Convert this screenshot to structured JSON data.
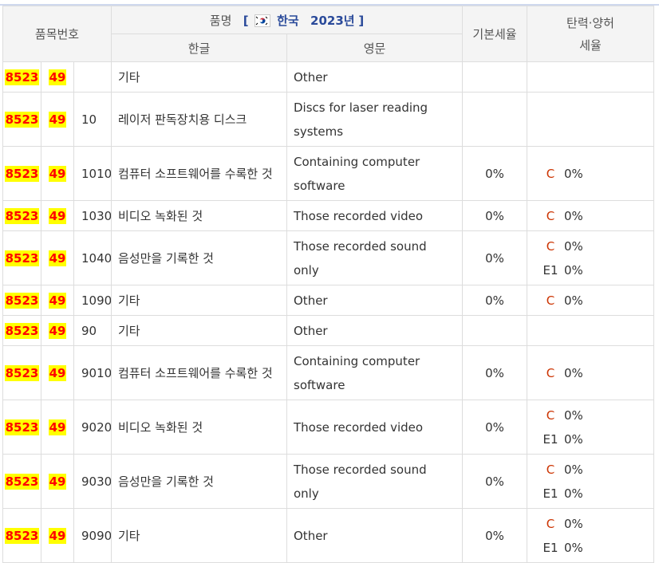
{
  "header": {
    "pumbun": "품목번호",
    "pummyeong": "품명",
    "bracket_open": "[",
    "country": "한국",
    "year": "2023년",
    "bracket_close": "]",
    "hangul": "한글",
    "english": "영문",
    "base_rate": "기본세율",
    "flex_rate_line1": "탄력·양허",
    "flex_rate_line2": "세율"
  },
  "flag_icon": "south-korea-flag-icon",
  "colors": {
    "highlight_bg": "#ffff00",
    "highlight_text": "#ff0000",
    "rate_code": "#cc3300",
    "title": "#2a4a9a"
  },
  "rows": [
    {
      "c1": "8523",
      "c2": "49",
      "c3": "",
      "kr": "기타",
      "en": "Other",
      "base": "",
      "rates": []
    },
    {
      "c1": "8523",
      "c2": "49",
      "c3": "10",
      "kr": "레이저 판독장치용 디스크",
      "en": "Discs for laser reading systems",
      "base": "",
      "rates": []
    },
    {
      "c1": "8523",
      "c2": "49",
      "c3": "1010",
      "kr": "컴퓨터 소프트웨어를 수록한 것",
      "en": "Containing computer software",
      "base": "0%",
      "rates": [
        {
          "code": "C",
          "value": "0%"
        }
      ]
    },
    {
      "c1": "8523",
      "c2": "49",
      "c3": "1030",
      "kr": "비디오 녹화된 것",
      "en": "Those recorded video",
      "base": "0%",
      "rates": [
        {
          "code": "C",
          "value": "0%"
        }
      ]
    },
    {
      "c1": "8523",
      "c2": "49",
      "c3": "1040",
      "kr": "음성만을 기록한 것",
      "en": "Those recorded sound only",
      "base": "0%",
      "rates": [
        {
          "code": "C",
          "value": "0%"
        },
        {
          "code": "E1",
          "value": "0%"
        }
      ]
    },
    {
      "c1": "8523",
      "c2": "49",
      "c3": "1090",
      "kr": "기타",
      "en": "Other",
      "base": "0%",
      "rates": [
        {
          "code": "C",
          "value": "0%"
        }
      ]
    },
    {
      "c1": "8523",
      "c2": "49",
      "c3": "90",
      "kr": "기타",
      "en": "Other",
      "base": "",
      "rates": []
    },
    {
      "c1": "8523",
      "c2": "49",
      "c3": "9010",
      "kr": "컴퓨터 소프트웨어를 수록한 것",
      "en": "Containing computer software",
      "base": "0%",
      "rates": [
        {
          "code": "C",
          "value": "0%"
        }
      ]
    },
    {
      "c1": "8523",
      "c2": "49",
      "c3": "9020",
      "kr": "비디오 녹화된 것",
      "en": "Those recorded video",
      "base": "0%",
      "rates": [
        {
          "code": "C",
          "value": "0%"
        },
        {
          "code": "E1",
          "value": "0%"
        }
      ]
    },
    {
      "c1": "8523",
      "c2": "49",
      "c3": "9030",
      "kr": "음성만을 기록한 것",
      "en": "Those recorded sound only",
      "base": "0%",
      "rates": [
        {
          "code": "C",
          "value": "0%"
        },
        {
          "code": "E1",
          "value": "0%"
        }
      ]
    },
    {
      "c1": "8523",
      "c2": "49",
      "c3": "9090",
      "kr": "기타",
      "en": "Other",
      "base": "0%",
      "rates": [
        {
          "code": "C",
          "value": "0%"
        },
        {
          "code": "E1",
          "value": "0%"
        }
      ]
    }
  ]
}
